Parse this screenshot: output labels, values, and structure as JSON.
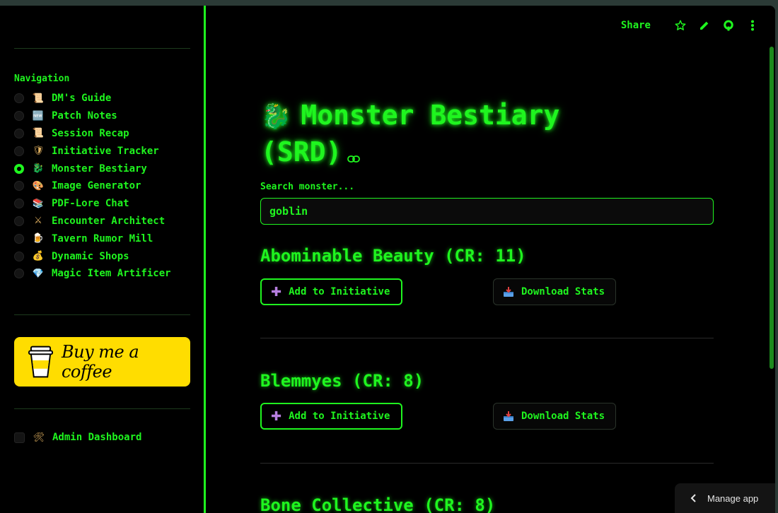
{
  "sidebar": {
    "nav_title": "Navigation",
    "items": [
      {
        "emoji": "📜",
        "label": "DM's Guide",
        "selected": false
      },
      {
        "emoji": "🆕",
        "label": "Patch Notes",
        "selected": false
      },
      {
        "emoji": "📜",
        "label": "Session Recap",
        "selected": false
      },
      {
        "emoji": "🛡",
        "label": "Initiative Tracker",
        "selected": false
      },
      {
        "emoji": "🐉",
        "label": "Monster Bestiary",
        "selected": true
      },
      {
        "emoji": "🎨",
        "label": "Image Generator",
        "selected": false
      },
      {
        "emoji": "📚",
        "label": "PDF-Lore Chat",
        "selected": false
      },
      {
        "emoji": "⚔",
        "label": "Encounter Architect",
        "selected": false
      },
      {
        "emoji": "🍺",
        "label": "Tavern Rumor Mill",
        "selected": false
      },
      {
        "emoji": "💰",
        "label": "Dynamic Shops",
        "selected": false
      },
      {
        "emoji": "💎",
        "label": "Magic Item Artificer",
        "selected": false
      }
    ],
    "coffee_label": "Buy me a coffee",
    "admin": {
      "emoji": "🛠",
      "label": "Admin Dashboard",
      "checked": false
    }
  },
  "toolbar": {
    "share_label": "Share"
  },
  "main": {
    "title_emoji": "🐉",
    "title": "Monster Bestiary (SRD)",
    "search_label": "Search monster...",
    "search_value": "goblin",
    "monsters": [
      {
        "name": "Abominable Beauty (CR: 11)",
        "add_label": "Add to Initiative",
        "download_label": "Download Stats"
      },
      {
        "name": "Blemmyes (CR: 8)",
        "add_label": "Add to Initiative",
        "download_label": "Download Stats"
      },
      {
        "name": "Bone Collective (CR: 8)"
      }
    ]
  },
  "manage_app_label": "Manage app",
  "colors": {
    "accent": "#1ff51f",
    "background": "#000000",
    "coffee": "#ffdd00"
  }
}
